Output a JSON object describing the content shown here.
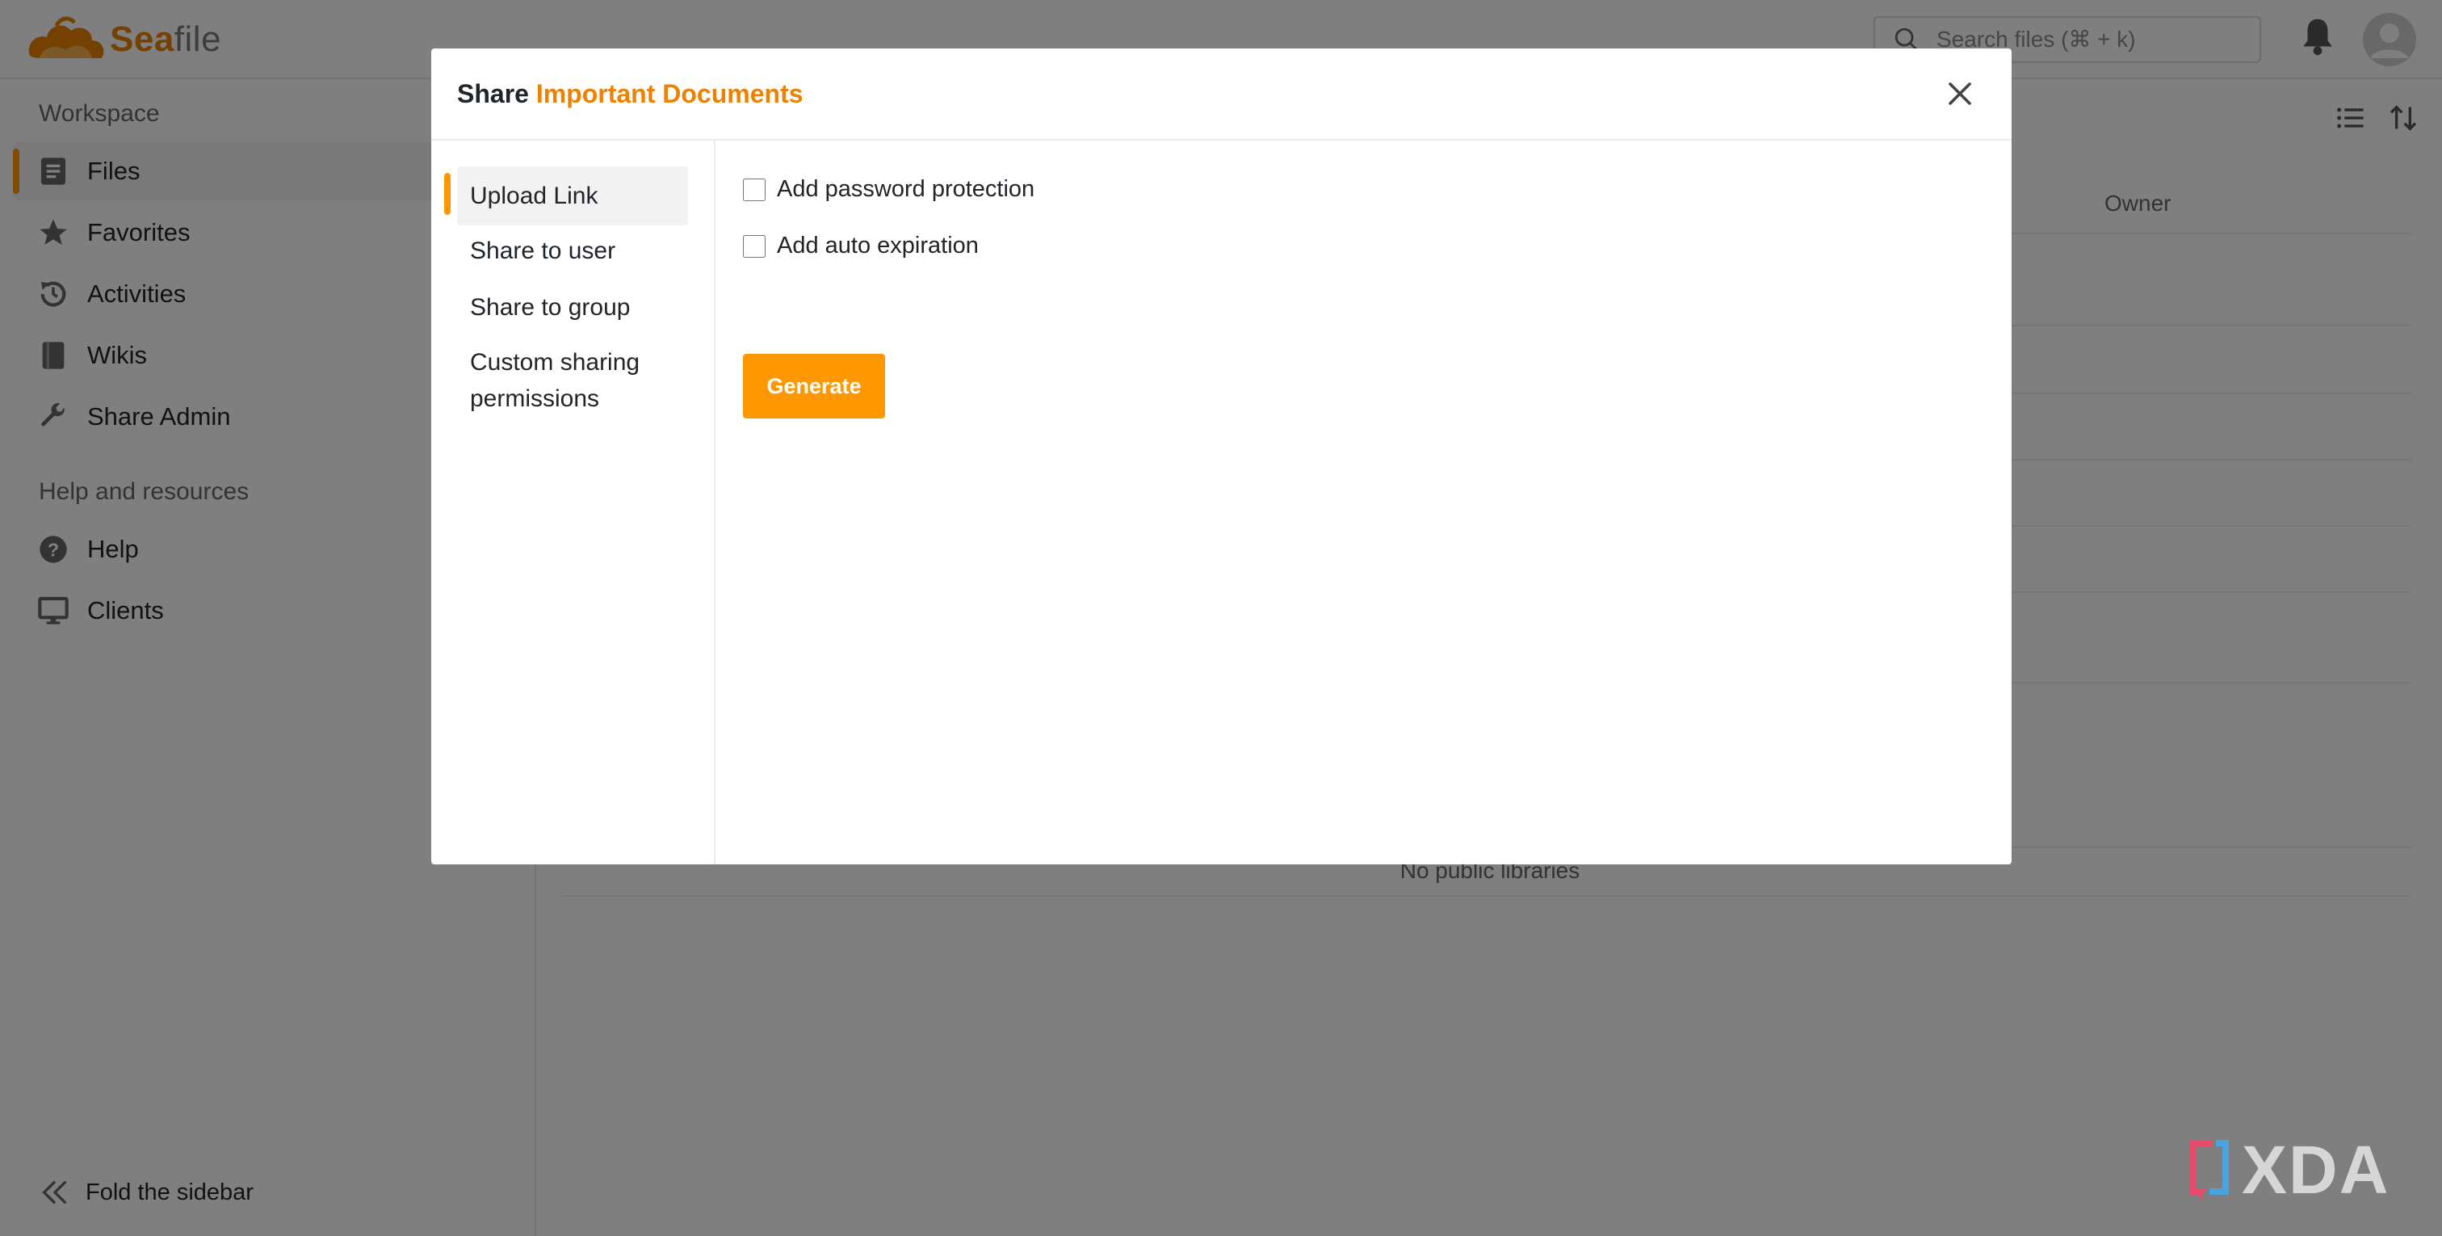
{
  "app": {
    "logo_sea": "Sea",
    "logo_file": "file",
    "search_placeholder": "Search files (⌘ + k)"
  },
  "sidebar": {
    "workspace_heading": "Workspace",
    "workspace_items": [
      {
        "label": "Files",
        "icon": "files-icon",
        "active": true
      },
      {
        "label": "Favorites",
        "icon": "star-icon"
      },
      {
        "label": "Activities",
        "icon": "history-icon"
      },
      {
        "label": "Wikis",
        "icon": "book-icon"
      },
      {
        "label": "Share Admin",
        "icon": "wrench-icon"
      }
    ],
    "help_heading": "Help and resources",
    "help_items": [
      {
        "label": "Help",
        "icon": "help-icon"
      },
      {
        "label": "Clients",
        "icon": "monitor-icon"
      }
    ],
    "fold_label": "Fold the sidebar"
  },
  "main": {
    "owner_header": "Owner",
    "empty_message": "No public libraries"
  },
  "modal": {
    "title_prefix": "Share",
    "title_item": "Important Documents",
    "nav": [
      {
        "label": "Upload Link",
        "active": true
      },
      {
        "label": "Share to user"
      },
      {
        "label": "Share to group"
      },
      {
        "label": "Custom sharing permissions"
      }
    ],
    "options": [
      {
        "label": "Add password protection",
        "checked": false
      },
      {
        "label": "Add auto expiration",
        "checked": false
      }
    ],
    "generate_label": "Generate"
  },
  "watermark": "XDA",
  "colors": {
    "accent": "#ff9800",
    "brand": "#eb8205",
    "overlay": "rgba(0,0,0,0.5)"
  }
}
